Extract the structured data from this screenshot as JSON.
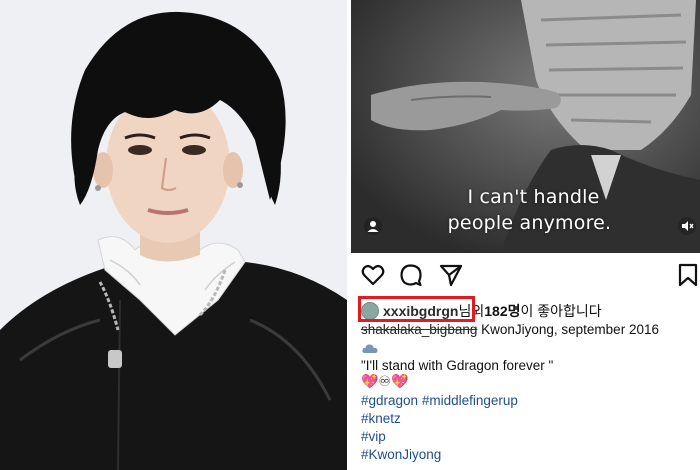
{
  "post": {
    "subtitle_line1": "I can't handle",
    "subtitle_line2": "people anymore.",
    "liker_username": "xxxibgdrgn",
    "likes_suffix": "님",
    "likes_middle": " 외 ",
    "likes_count": "182명",
    "likes_end": "이 좋아합니다",
    "caption_line1_blurred": "shakalaka_bigbang",
    "caption_line1_rest": " KwonJiyong, september 2016",
    "caption_quote": "\"I'll stand with Gdragon forever \"",
    "caption_emojis": "💖♾💖",
    "hashtags": [
      "#gdragon",
      "#middlefingerup",
      "#knetz",
      "#vip",
      "#KwonJiyong"
    ]
  },
  "icons": {
    "like": "heart-icon",
    "comment": "comment-icon",
    "share": "send-icon",
    "save": "bookmark-icon",
    "user_tag": "person-icon",
    "mute": "mute-icon"
  },
  "colors": {
    "highlight_box": "#e21b23",
    "hashtag": "#1f4e8c"
  }
}
